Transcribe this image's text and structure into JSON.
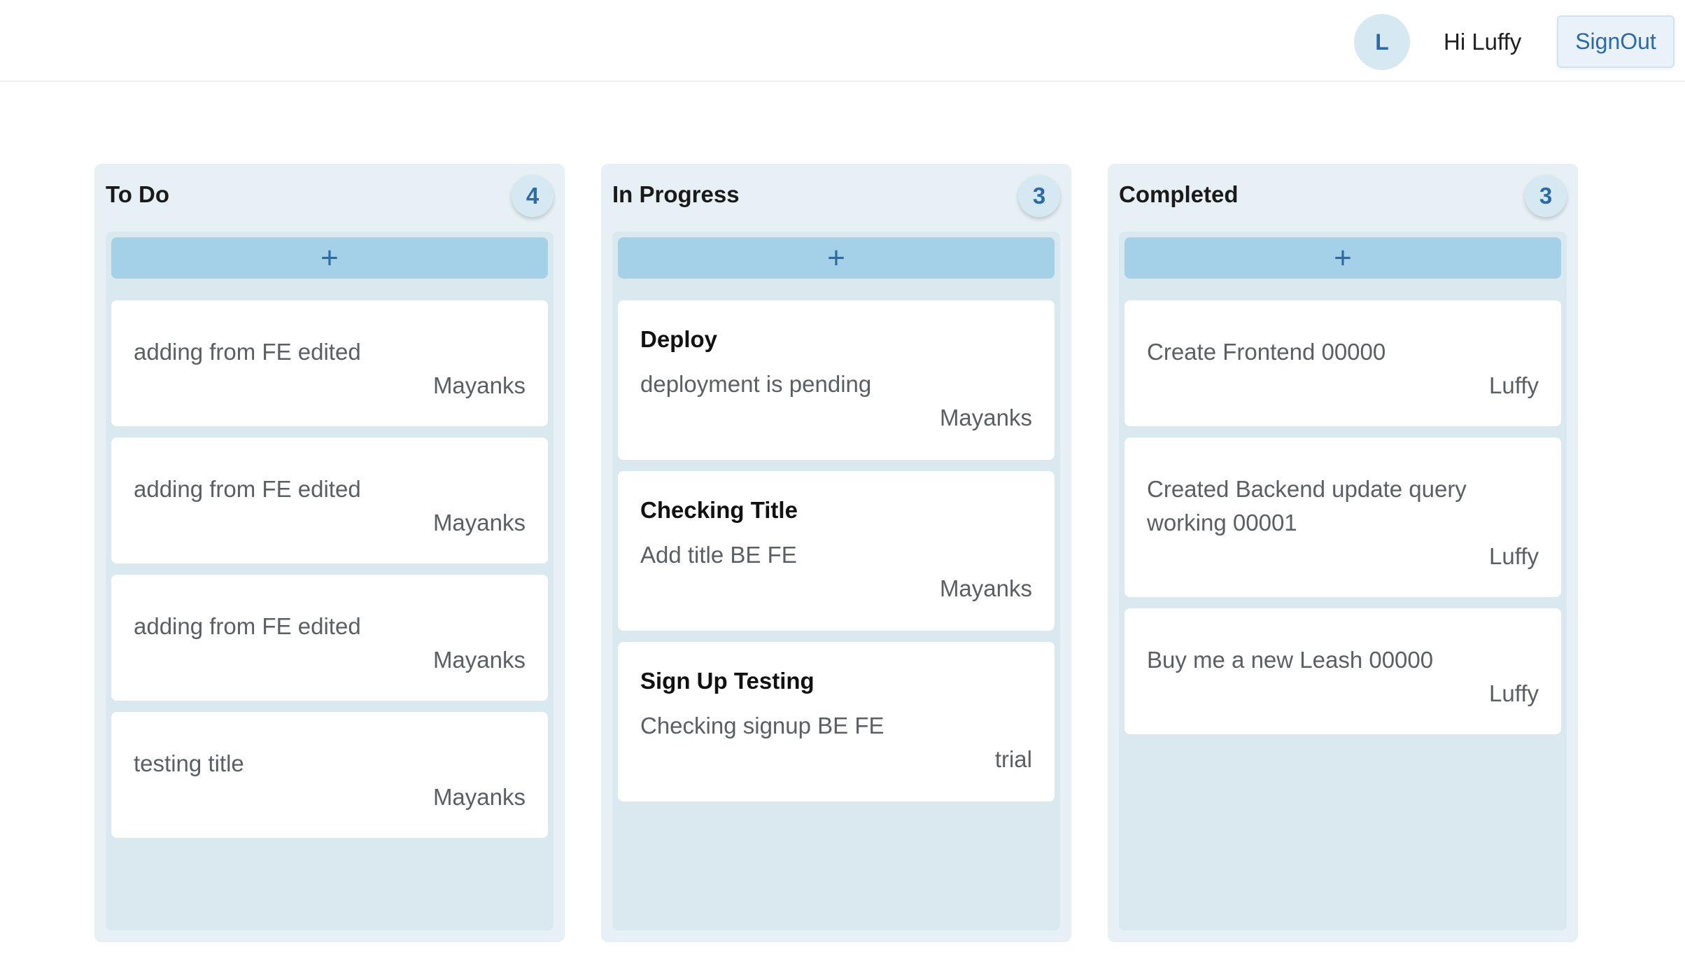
{
  "header": {
    "avatar_initial": "L",
    "greeting": "Hi Luffy",
    "signout_label": "SignOut"
  },
  "columns": [
    {
      "title": "To Do",
      "count": "4",
      "add_label": "+",
      "cards": [
        {
          "title": "",
          "description": "adding from FE edited",
          "owner": "Mayanks"
        },
        {
          "title": "",
          "description": "adding from FE edited",
          "owner": "Mayanks"
        },
        {
          "title": "",
          "description": "adding from FE edited",
          "owner": "Mayanks"
        },
        {
          "title": "",
          "description": "testing title",
          "owner": "Mayanks"
        }
      ]
    },
    {
      "title": "In Progress",
      "count": "3",
      "add_label": "+",
      "cards": [
        {
          "title": "Deploy",
          "description": "deployment is pending",
          "owner": "Mayanks"
        },
        {
          "title": "Checking Title",
          "description": "Add title BE FE",
          "owner": "Mayanks"
        },
        {
          "title": "Sign Up Testing",
          "description": "Checking signup BE FE",
          "owner": "trial"
        }
      ]
    },
    {
      "title": "Completed",
      "count": "3",
      "add_label": "+",
      "cards": [
        {
          "title": "",
          "description": "Create Frontend 00000",
          "owner": "Luffy"
        },
        {
          "title": "",
          "description": "Created Backend update query working 00001",
          "owner": "Luffy"
        },
        {
          "title": "",
          "description": "Buy me a new Leash 00000",
          "owner": "Luffy"
        }
      ]
    }
  ]
}
